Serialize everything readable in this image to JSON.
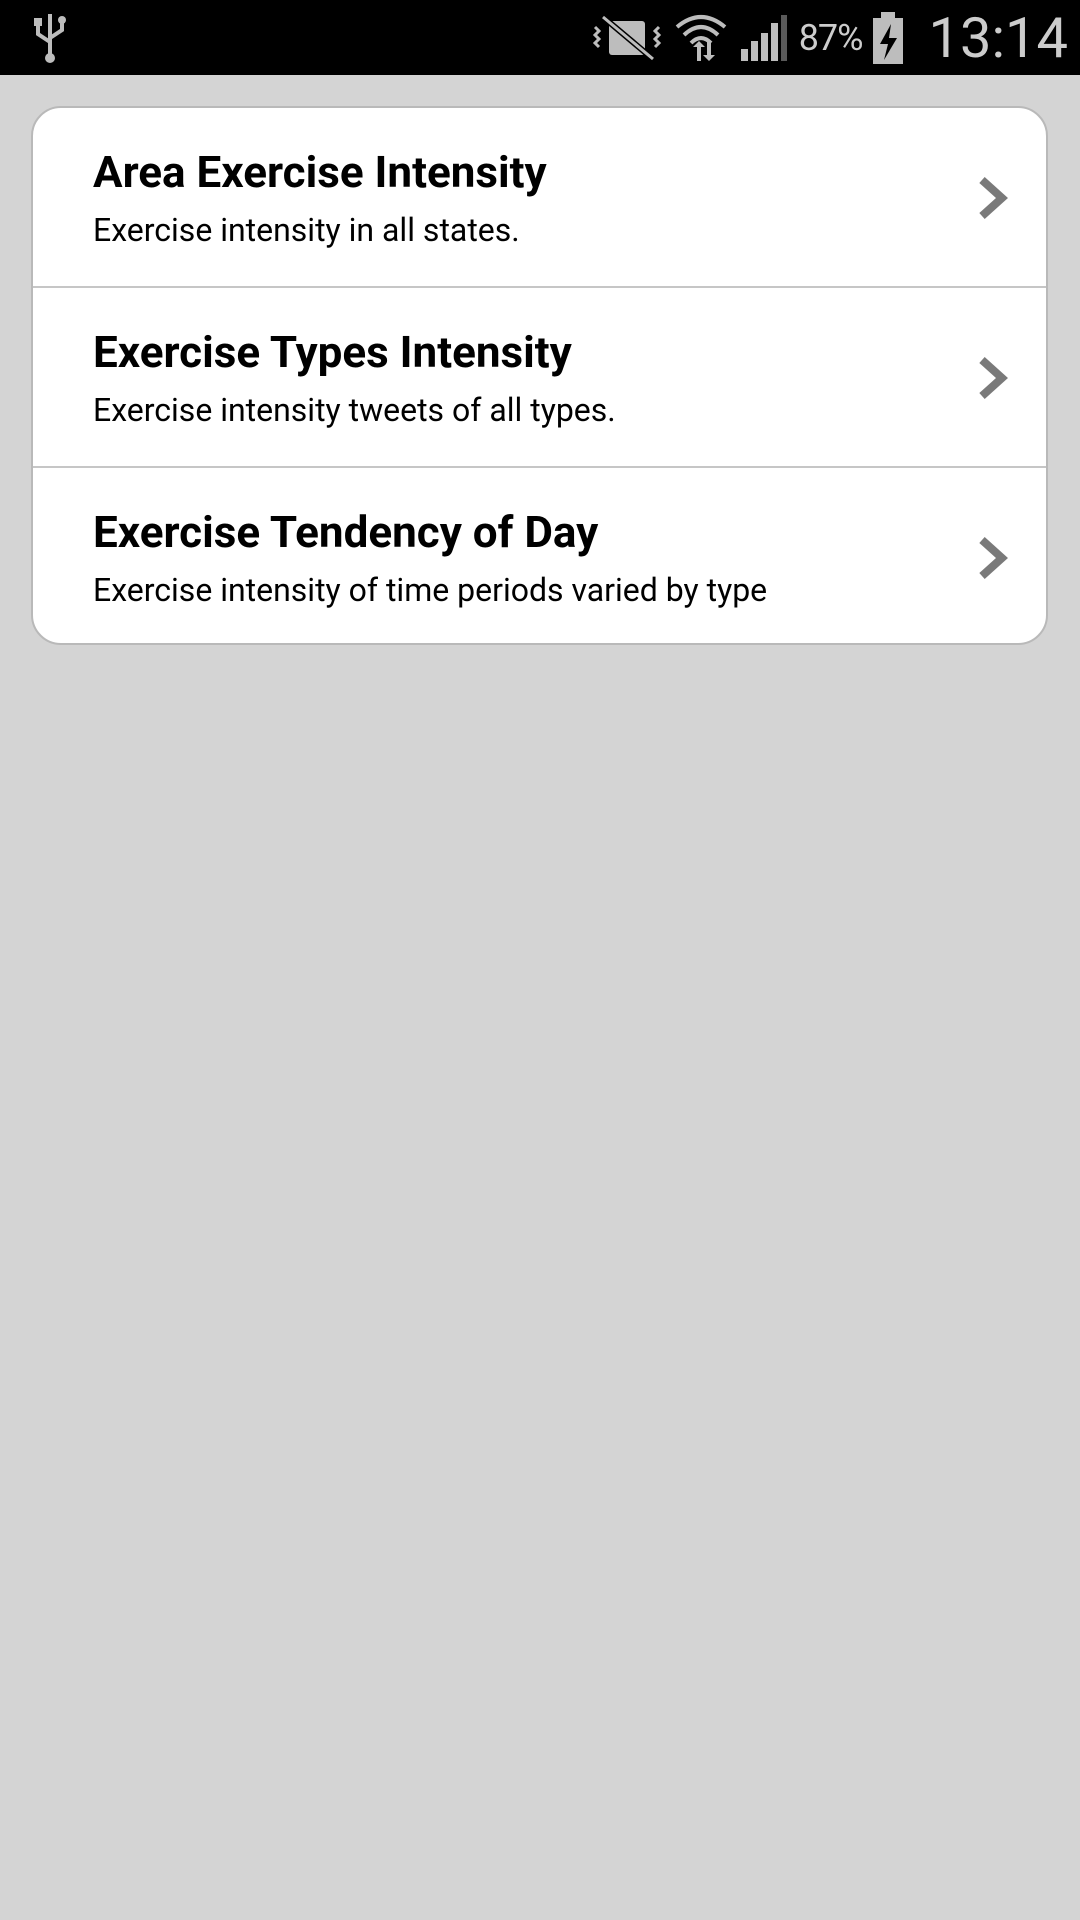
{
  "status_bar": {
    "battery_percent": "87%",
    "time": "13:14",
    "icons": [
      "usb-icon",
      "vibrate-mute-icon",
      "wifi-icon",
      "signal-icon",
      "battery-charging-icon"
    ]
  },
  "menu": {
    "items": [
      {
        "title": "Area Exercise Intensity",
        "subtitle": "Exercise intensity in all states."
      },
      {
        "title": "Exercise Types Intensity",
        "subtitle": "Exercise intensity tweets of all types."
      },
      {
        "title": "Exercise Tendency of Day",
        "subtitle": "Exercise intensity of time periods varied by type"
      }
    ]
  },
  "colors": {
    "background": "#d4d4d4",
    "card": "#ffffff",
    "status_bar": "#000000",
    "chevron": "#7a7a7a"
  }
}
